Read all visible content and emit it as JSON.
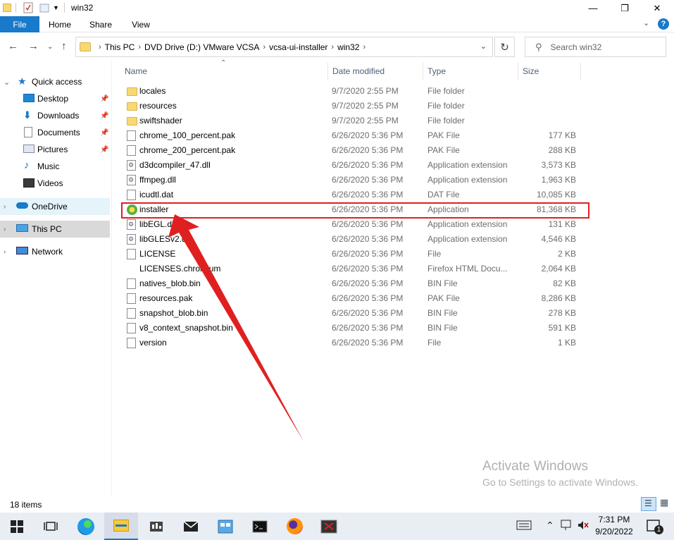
{
  "window": {
    "title": "win32",
    "controls": {
      "minimize": "—",
      "maximize": "❐",
      "close": "✕"
    }
  },
  "ribbon": {
    "tabs": [
      "File",
      "Home",
      "Share",
      "View"
    ],
    "accent": "#1979ca"
  },
  "address": {
    "crumbs": [
      "This PC",
      "DVD Drive (D:) VMware VCSA",
      "vcsa-ui-installer",
      "win32"
    ]
  },
  "search": {
    "placeholder": "Search win32"
  },
  "nav": {
    "items": [
      {
        "label": "Quick access",
        "icon": "star-icon"
      },
      {
        "label": "Desktop",
        "icon": "desktop-icon",
        "pinned": true
      },
      {
        "label": "Downloads",
        "icon": "download-icon",
        "pinned": true
      },
      {
        "label": "Documents",
        "icon": "documents-icon",
        "pinned": true
      },
      {
        "label": "Pictures",
        "icon": "pictures-icon",
        "pinned": true
      },
      {
        "label": "Music",
        "icon": "music-icon"
      },
      {
        "label": "Videos",
        "icon": "videos-icon"
      },
      {
        "label": "OneDrive",
        "icon": "cloud-icon"
      },
      {
        "label": "This PC",
        "icon": "computer-icon"
      },
      {
        "label": "Network",
        "icon": "network-icon"
      }
    ]
  },
  "columns": [
    "Name",
    "Date modified",
    "Type",
    "Size"
  ],
  "files": [
    {
      "name": "locales",
      "date": "9/7/2020 2:55 PM",
      "type": "File folder",
      "size": "",
      "icon": "folder"
    },
    {
      "name": "resources",
      "date": "9/7/2020 2:55 PM",
      "type": "File folder",
      "size": "",
      "icon": "folder"
    },
    {
      "name": "swiftshader",
      "date": "9/7/2020 2:55 PM",
      "type": "File folder",
      "size": "",
      "icon": "folder"
    },
    {
      "name": "chrome_100_percent.pak",
      "date": "6/26/2020 5:36 PM",
      "type": "PAK File",
      "size": "177 KB",
      "icon": "file"
    },
    {
      "name": "chrome_200_percent.pak",
      "date": "6/26/2020 5:36 PM",
      "type": "PAK File",
      "size": "288 KB",
      "icon": "file"
    },
    {
      "name": "d3dcompiler_47.dll",
      "date": "6/26/2020 5:36 PM",
      "type": "Application extension",
      "size": "3,573 KB",
      "icon": "dll"
    },
    {
      "name": "ffmpeg.dll",
      "date": "6/26/2020 5:36 PM",
      "type": "Application extension",
      "size": "1,963 KB",
      "icon": "dll"
    },
    {
      "name": "icudtl.dat",
      "date": "6/26/2020 5:36 PM",
      "type": "DAT File",
      "size": "10,085 KB",
      "icon": "file"
    },
    {
      "name": "installer",
      "date": "6/26/2020 5:36 PM",
      "type": "Application",
      "size": "81,368 KB",
      "icon": "app"
    },
    {
      "name": "libEGL.dll",
      "date": "6/26/2020 5:36 PM",
      "type": "Application extension",
      "size": "131 KB",
      "icon": "dll"
    },
    {
      "name": "libGLESv2.dll",
      "date": "6/26/2020 5:36 PM",
      "type": "Application extension",
      "size": "4,546 KB",
      "icon": "dll"
    },
    {
      "name": "LICENSE",
      "date": "6/26/2020 5:36 PM",
      "type": "File",
      "size": "2 KB",
      "icon": "file"
    },
    {
      "name": "LICENSES.chromium",
      "date": "6/26/2020 5:36 PM",
      "type": "Firefox HTML Docu...",
      "size": "2,064 KB",
      "icon": "firefox"
    },
    {
      "name": "natives_blob.bin",
      "date": "6/26/2020 5:36 PM",
      "type": "BIN File",
      "size": "82 KB",
      "icon": "file"
    },
    {
      "name": "resources.pak",
      "date": "6/26/2020 5:36 PM",
      "type": "PAK File",
      "size": "8,286 KB",
      "icon": "file"
    },
    {
      "name": "snapshot_blob.bin",
      "date": "6/26/2020 5:36 PM",
      "type": "BIN File",
      "size": "278 KB",
      "icon": "file"
    },
    {
      "name": "v8_context_snapshot.bin",
      "date": "6/26/2020 5:36 PM",
      "type": "BIN File",
      "size": "591 KB",
      "icon": "file"
    },
    {
      "name": "version",
      "date": "6/26/2020 5:36 PM",
      "type": "File",
      "size": "1 KB",
      "icon": "file"
    }
  ],
  "annotation": {
    "color": "#e02020"
  },
  "watermark": {
    "line1": "Activate Windows",
    "line2": "Go to Settings to activate Windows."
  },
  "status": {
    "count": "18 items"
  },
  "taskbar": {
    "time": "7:31 PM",
    "date": "9/20/2022",
    "notifications": "1"
  }
}
